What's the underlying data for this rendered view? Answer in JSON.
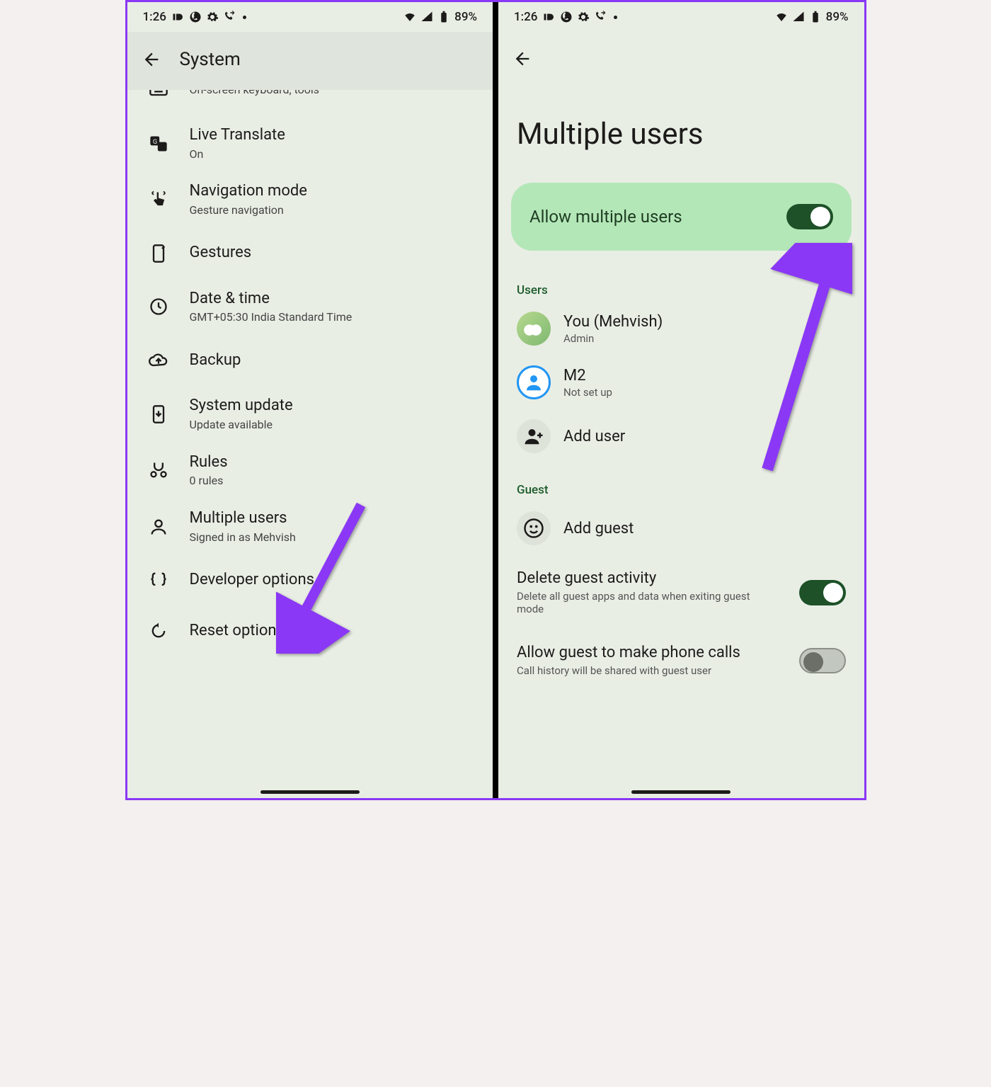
{
  "status": {
    "time": "1:26",
    "battery": "89%"
  },
  "left": {
    "title": "System",
    "rows": [
      {
        "id": "keyboard",
        "title": "",
        "sub": "On-screen keyboard, tools"
      },
      {
        "id": "live-translate",
        "title": "Live Translate",
        "sub": "On"
      },
      {
        "id": "navigation",
        "title": "Navigation mode",
        "sub": "Gesture navigation"
      },
      {
        "id": "gestures",
        "title": "Gestures",
        "sub": ""
      },
      {
        "id": "datetime",
        "title": "Date & time",
        "sub": "GMT+05:30 India Standard Time"
      },
      {
        "id": "backup",
        "title": "Backup",
        "sub": ""
      },
      {
        "id": "update",
        "title": "System update",
        "sub": "Update available"
      },
      {
        "id": "rules",
        "title": "Rules",
        "sub": "0 rules"
      },
      {
        "id": "multiusers",
        "title": "Multiple users",
        "sub": "Signed in as Mehvish"
      },
      {
        "id": "developer",
        "title": "Developer options",
        "sub": ""
      },
      {
        "id": "reset",
        "title": "Reset options",
        "sub": ""
      }
    ]
  },
  "right": {
    "title": "Multiple users",
    "toggle_label": "Allow multiple users",
    "section_users": "Users",
    "users": [
      {
        "title": "You (Mehvish)",
        "sub": "Admin"
      },
      {
        "title": "M2",
        "sub": "Not set up"
      },
      {
        "title": "Add user",
        "sub": ""
      }
    ],
    "section_guest": "Guest",
    "add_guest": "Add guest",
    "delete_guest_title": "Delete guest activity",
    "delete_guest_sub": "Delete all guest apps and data when exiting guest mode",
    "guest_calls_title": "Allow guest to make phone calls",
    "guest_calls_sub": "Call history will be shared with guest user"
  },
  "colors": {
    "arrow": "#8a38f5"
  }
}
